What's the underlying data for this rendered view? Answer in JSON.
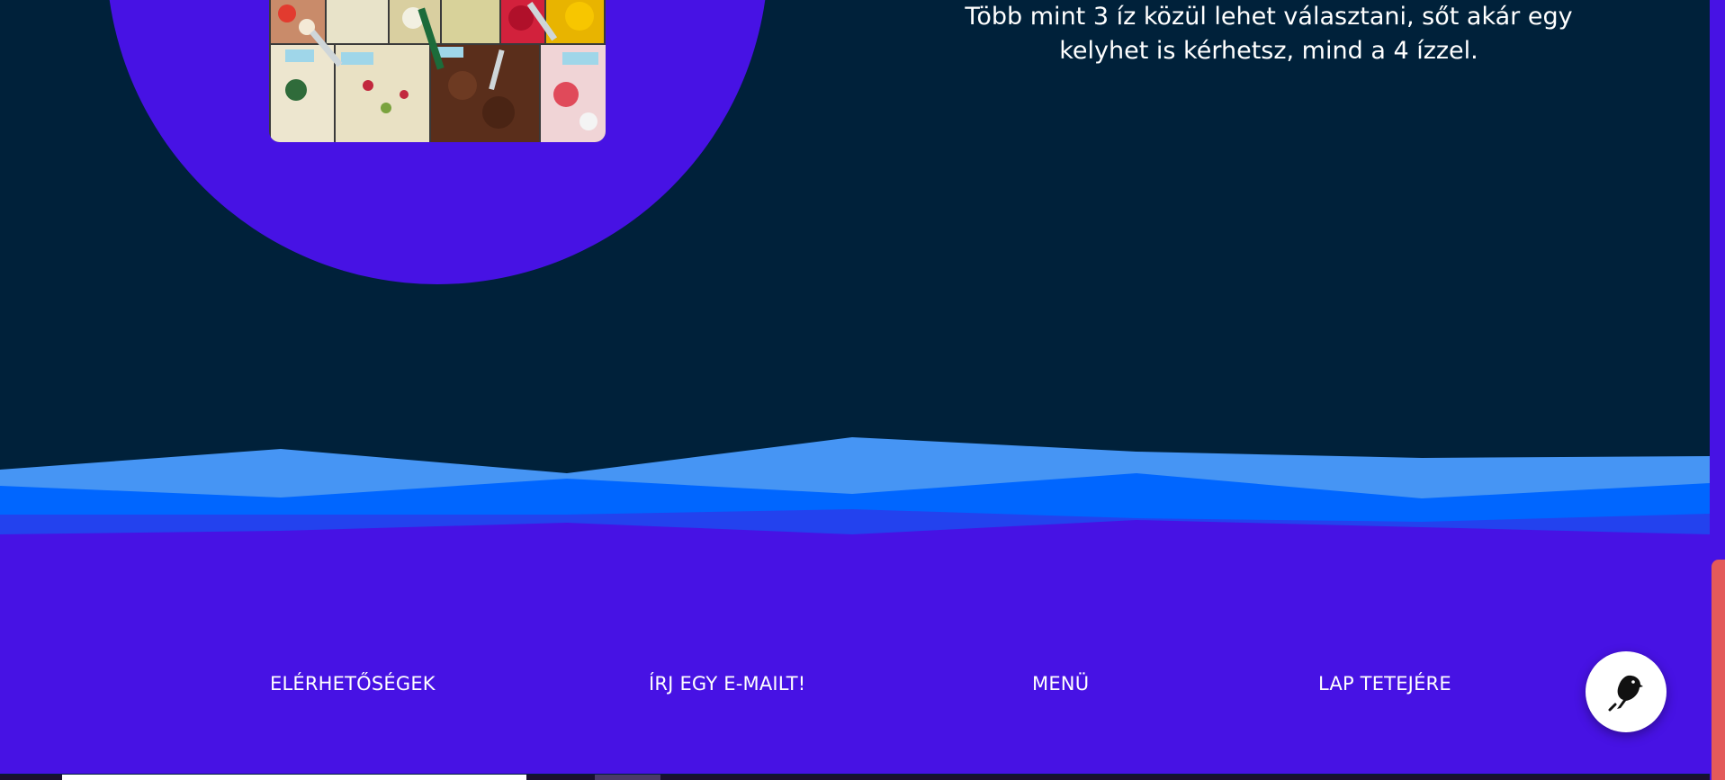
{
  "intro": {
    "text": "Több mint 3 íz közül lehet választani, sőt akár egy kelyhet is kérhetsz, mind a 4 ízzel."
  },
  "footer": {
    "links": [
      {
        "label": "ELÉRHETŐSÉGEK"
      },
      {
        "label": "ÍRJ EGY E-MAILT!"
      },
      {
        "label": "MENÜ"
      },
      {
        "label": "LAP TETEJÉRE"
      }
    ]
  },
  "chat": {
    "icon": "bird-icon"
  },
  "colors": {
    "background": "#00213a",
    "accent_purple": "#4712e4",
    "wave_light": "#4695f4",
    "wave_mid": "#0066ff",
    "wave_deep": "#2342ee",
    "scrollbar_thumb": "#e35a5a"
  }
}
